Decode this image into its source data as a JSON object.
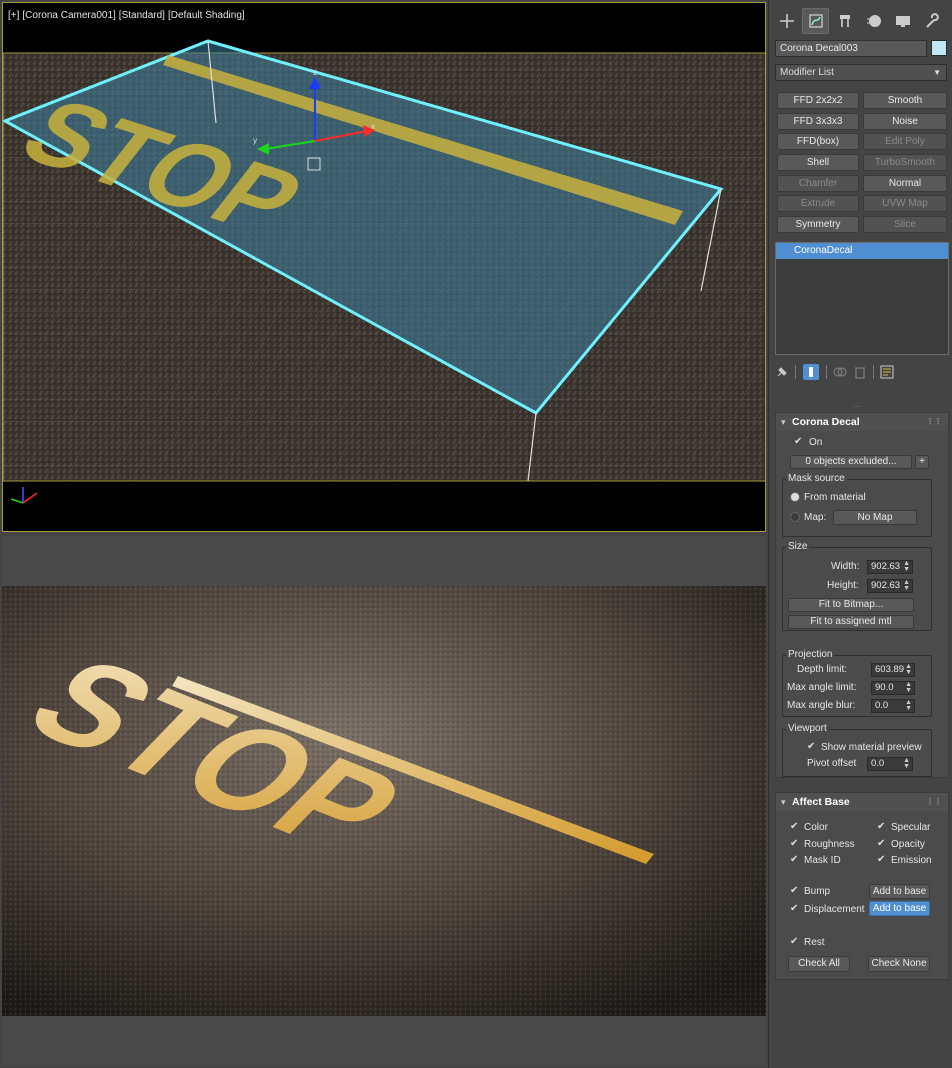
{
  "viewport": {
    "label_parts": [
      "[+]",
      "[Corona Camera001]",
      "[Standard]",
      "[Default Shading]"
    ],
    "decal_text": "STOP"
  },
  "render": {
    "decal_text": "STOP"
  },
  "panel": {
    "tabs": [
      {
        "icon": "create-icon"
      },
      {
        "icon": "modify-icon"
      },
      {
        "icon": "hierarchy-icon"
      },
      {
        "icon": "motion-icon"
      },
      {
        "icon": "display-icon"
      },
      {
        "icon": "utilities-icon"
      }
    ],
    "object_name": "Corona Decal003",
    "object_color": "#bfe8f2",
    "modifier_list": "Modifier List",
    "modifier_buttons": [
      {
        "label": "FFD 2x2x2",
        "enabled": true
      },
      {
        "label": "Smooth",
        "enabled": true
      },
      {
        "label": "FFD 3x3x3",
        "enabled": true
      },
      {
        "label": "Noise",
        "enabled": true
      },
      {
        "label": "FFD(box)",
        "enabled": true
      },
      {
        "label": "Edit Poly",
        "enabled": false
      },
      {
        "label": "Shell",
        "enabled": true
      },
      {
        "label": "TurboSmooth",
        "enabled": false
      },
      {
        "label": "Chamfer",
        "enabled": false
      },
      {
        "label": "Normal",
        "enabled": true
      },
      {
        "label": "Extrude",
        "enabled": false
      },
      {
        "label": "UVW Map",
        "enabled": false
      },
      {
        "label": "Symmetry",
        "enabled": true
      },
      {
        "label": "Slice",
        "enabled": false
      }
    ],
    "stack_items": [
      "CoronaDecal"
    ],
    "corona_decal": {
      "title": "Corona Decal",
      "on_label": "On",
      "excluded_label": "0 objects excluded...",
      "excluded_add": "+",
      "mask_source": {
        "title": "Mask source",
        "from_material": "From material",
        "map_label": "Map:",
        "map_button": "No Map"
      },
      "size": {
        "title": "Size",
        "width_label": "Width:",
        "width_value": "902.63",
        "height_label": "Height:",
        "height_value": "902.63",
        "fit_bitmap": "Fit to Bitmap...",
        "fit_mtl": "Fit to assigned mtl"
      },
      "projection": {
        "title": "Projection",
        "depth_label": "Depth limit:",
        "depth_value": "603.89",
        "max_angle_label": "Max angle limit:",
        "max_angle_value": "90.0",
        "max_blur_label": "Max angle blur:",
        "max_blur_value": "0.0"
      },
      "viewport": {
        "title": "Viewport",
        "show_preview": "Show material preview",
        "pivot_label": "Pivot offset",
        "pivot_value": "0.0"
      }
    },
    "affect_base": {
      "title": "Affect Base",
      "color": "Color",
      "specular": "Specular",
      "roughness": "Roughness",
      "opacity": "Opacity",
      "mask_id": "Mask ID",
      "emission": "Emission",
      "bump": "Bump",
      "bump_btn": "Add to base",
      "displacement": "Displacement",
      "displacement_btn": "Add to base",
      "rest": "Rest",
      "check_all": "Check All",
      "check_none": "Check None"
    }
  }
}
